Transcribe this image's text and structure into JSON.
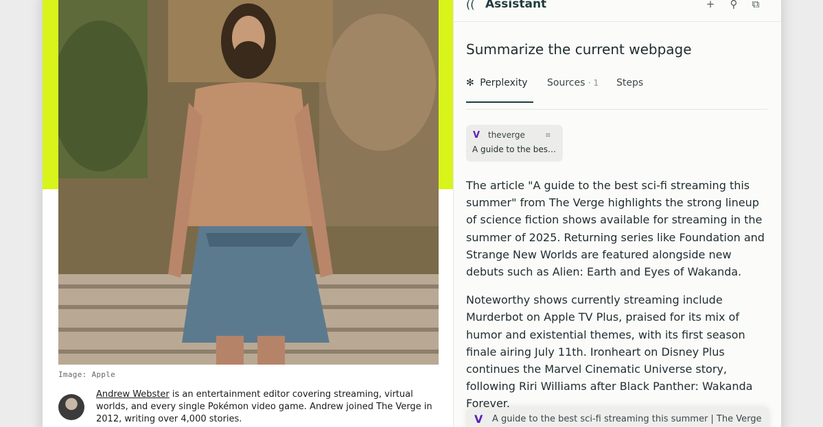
{
  "article": {
    "image_caption": "Image: Apple",
    "author_name": "Andrew Webster",
    "bio_rest": " is an entertainment editor covering streaming, virtual worlds, and every single Pokémon video game. Andrew joined The Verge in 2012, writing over 4,000 stories."
  },
  "assistant": {
    "title": "Assistant",
    "brand_icon": "assistant-waves-icon",
    "query": "Summarize the current webpage",
    "tabs": [
      {
        "label": "Perplexity",
        "icon": "perplexity-icon"
      },
      {
        "label": "Sources",
        "count": "· 1"
      },
      {
        "label": "Steps"
      }
    ],
    "source_card": {
      "domain": "theverge",
      "title": "A guide to the best..."
    },
    "answer_paragraphs": [
      "The article \"A guide to the best sci-fi streaming this summer\" from The Verge highlights the strong lineup of science fiction shows available for streaming in the summer of 2025. Returning series like Foundation and Strange New Worlds are featured alongside new debuts such as Alien: Earth and Eyes of Wakanda.",
      "Noteworthy shows currently streaming include Murderbot on Apple TV Plus, praised for its mix of humor and existential themes, with its first season finale airing July 11th. Ironheart on Disney Plus continues the Marvel Cinematic Universe story, following Riri Williams after Black Panther: Wakanda Forever."
    ],
    "citation": "A guide to the best sci-fi streaming this summer | The Verge"
  },
  "colors": {
    "accent_lime": "#d8f41a",
    "verge_purple": "#5b21b6",
    "assistant_text": "#1f3b3f"
  }
}
